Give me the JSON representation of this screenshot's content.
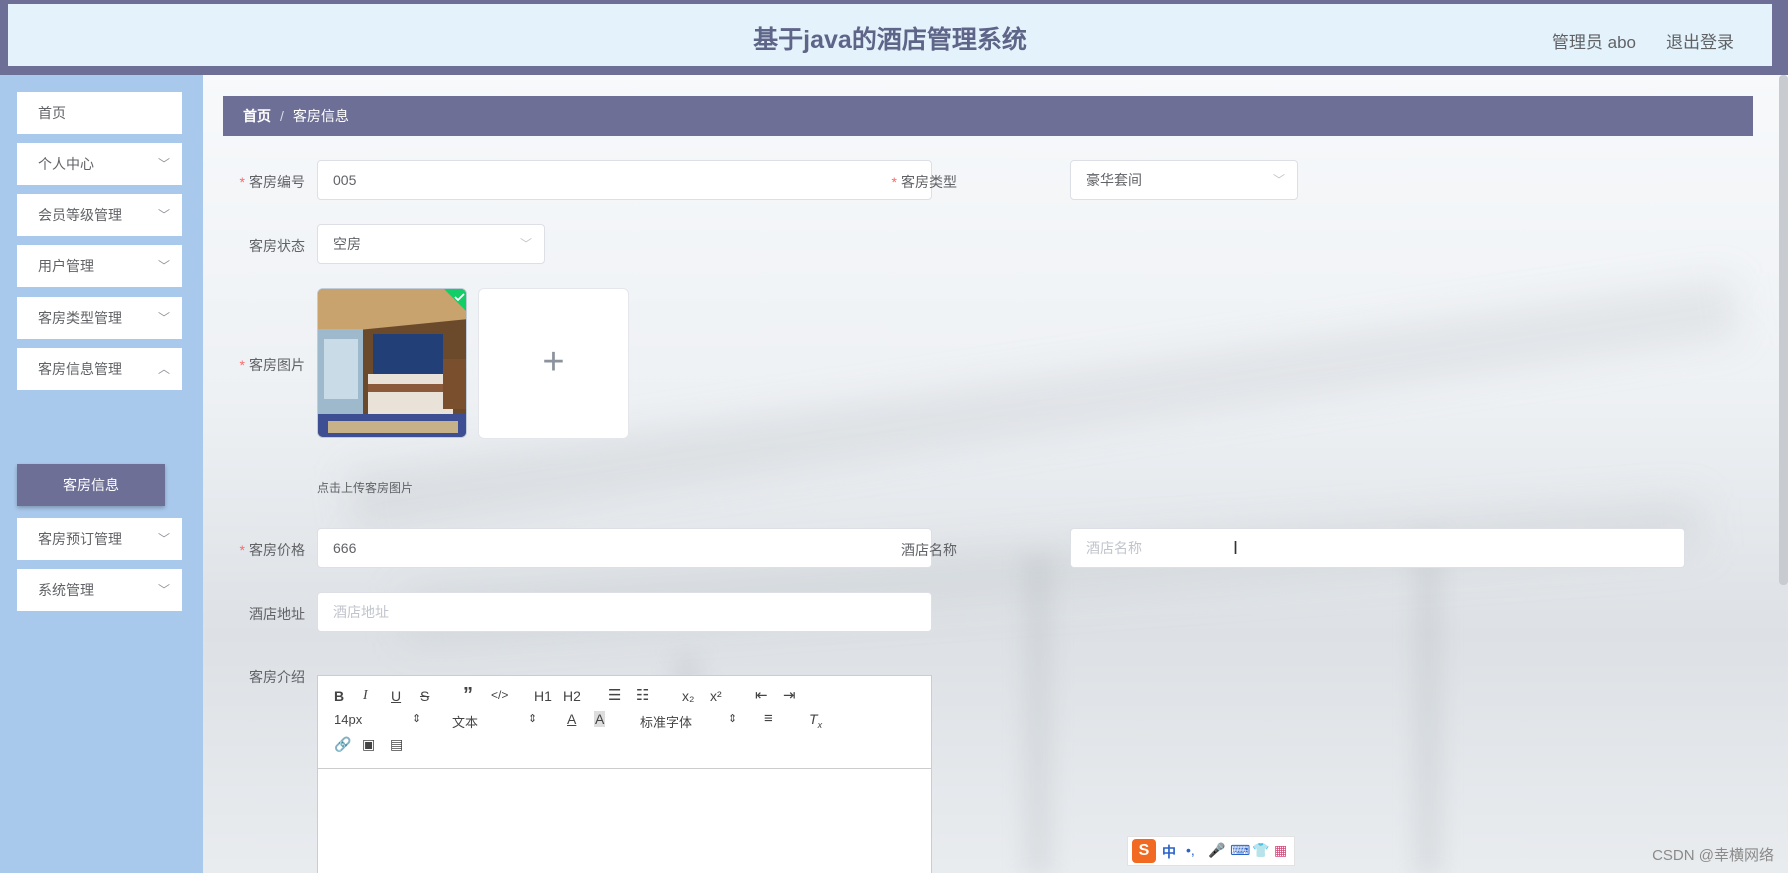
{
  "header": {
    "title": "基于java的酒店管理系统",
    "user": "管理员 abo",
    "logout": "退出登录"
  },
  "sidebar": {
    "items": [
      {
        "label": "首页"
      },
      {
        "label": "个人中心"
      },
      {
        "label": "会员等级管理"
      },
      {
        "label": "用户管理"
      },
      {
        "label": "客房类型管理"
      },
      {
        "label": "客房信息管理"
      },
      {
        "label": "客房预订管理"
      },
      {
        "label": "系统管理"
      }
    ],
    "active_sub": "客房信息"
  },
  "breadcrumb": {
    "home": "首页",
    "sep": "/",
    "current": "客房信息"
  },
  "form": {
    "room_no": {
      "label": "客房编号",
      "value": "005"
    },
    "room_type": {
      "label": "客房类型",
      "value": "豪华套间"
    },
    "room_status": {
      "label": "客房状态",
      "value": "空房"
    },
    "room_image": {
      "label": "客房图片",
      "tip": "点击上传客房图片"
    },
    "room_price": {
      "label": "客房价格",
      "value": "666"
    },
    "hotel_name": {
      "label": "酒店名称",
      "placeholder": "酒店名称"
    },
    "hotel_address": {
      "label": "酒店地址",
      "placeholder": "酒店地址"
    },
    "room_intro": {
      "label": "客房介绍"
    }
  },
  "editor": {
    "font_size": "14px",
    "block_type": "文本",
    "font_family": "标准字体",
    "h1": "H1",
    "h2": "H2"
  },
  "ime": {
    "mode": "中"
  },
  "watermark": "CSDN @幸横网络"
}
